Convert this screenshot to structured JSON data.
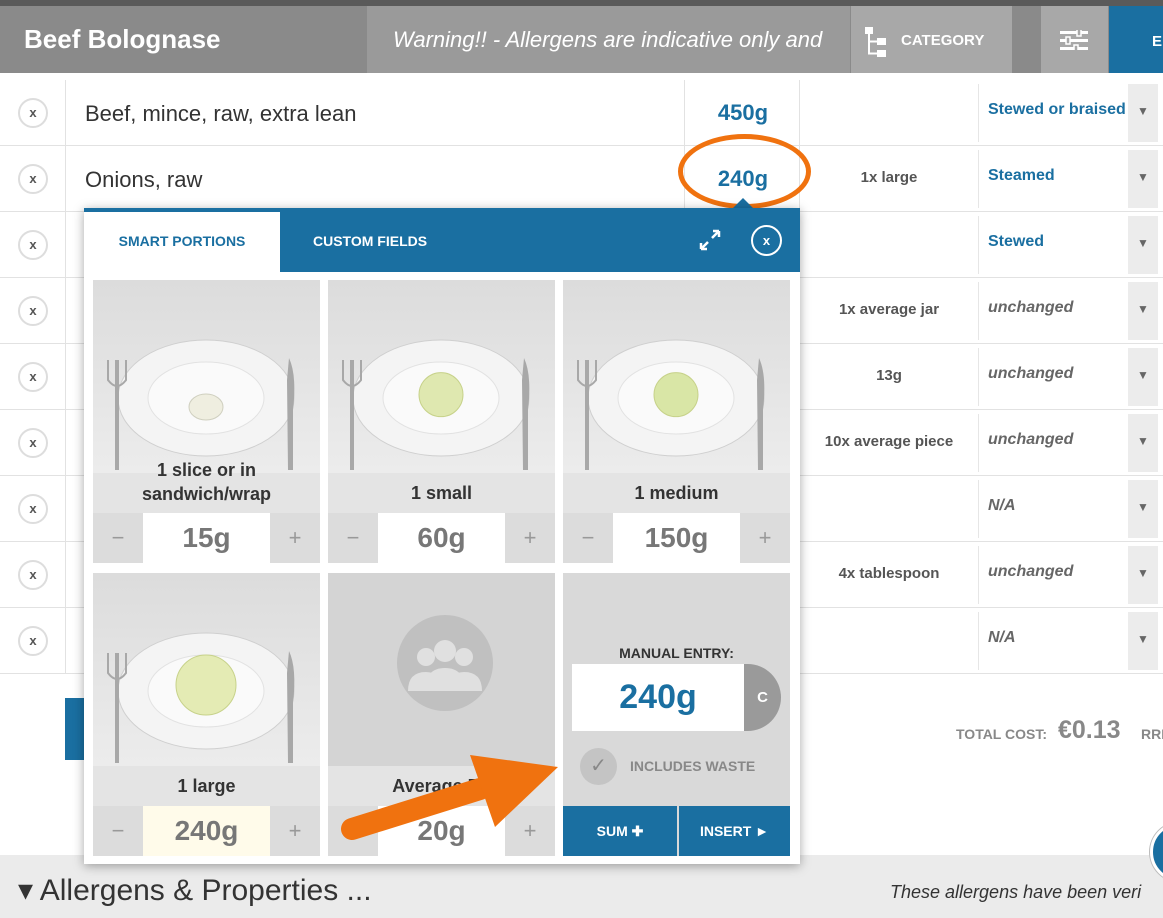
{
  "header": {
    "recipe_title": "Beef Bolognase",
    "warning": "Warning!! - Allergens are indicative only and",
    "category_label": "CATEGORY",
    "export_label": "E"
  },
  "rows": [
    {
      "remove": "x",
      "ingredient": "Beef, mince, raw, extra lean",
      "quantity": "450g",
      "portion": "",
      "cooking": "Stewed or braised"
    },
    {
      "remove": "x",
      "ingredient": "Onions, raw",
      "quantity": "240g",
      "portion": "1x large",
      "cooking": "Steamed"
    },
    {
      "remove": "x",
      "ingredient": "",
      "quantity": "",
      "portion": "",
      "cooking": "Stewed"
    },
    {
      "remove": "x",
      "ingredient": "",
      "quantity": "",
      "portion": "1x average jar",
      "cooking": "unchanged"
    },
    {
      "remove": "x",
      "ingredient": "",
      "quantity": "",
      "portion": "13g",
      "cooking": "unchanged"
    },
    {
      "remove": "x",
      "ingredient": "",
      "quantity": "",
      "portion": "10x average piece",
      "cooking": "unchanged"
    },
    {
      "remove": "x",
      "ingredient": "",
      "quantity": "",
      "portion": "",
      "cooking": "N/A"
    },
    {
      "remove": "x",
      "ingredient": "",
      "quantity": "",
      "portion": "4x tablespoon",
      "cooking": "unchanged"
    },
    {
      "remove": "x",
      "ingredient": "",
      "quantity": "",
      "portion": "",
      "cooking": "N/A"
    }
  ],
  "dropdown_glyph": "▼",
  "popup": {
    "tab_smart": "SMART PORTIONS",
    "tab_custom": "CUSTOM FIELDS",
    "close": "x",
    "cards": [
      {
        "label": "1 slice or in sandwich/wrap",
        "value": "15g",
        "minus": "−",
        "plus": "+"
      },
      {
        "label": "1 small",
        "value": "60g",
        "minus": "−",
        "plus": "+"
      },
      {
        "label": "1 medium",
        "value": "150g",
        "minus": "−",
        "plus": "+"
      },
      {
        "label": "1 large",
        "value": "240g",
        "minus": "−",
        "plus": "+"
      },
      {
        "label": "Average Po",
        "value": "20g",
        "minus": "−",
        "plus": "+"
      }
    ],
    "manual_label": "MANUAL ENTRY:",
    "manual_value": "240g",
    "clear_label": "C",
    "check_glyph": "✓",
    "waste_label": "INCLUDES WASTE",
    "sum_label": "SUM ✚",
    "insert_label": "INSERT ►"
  },
  "totals": {
    "cost_label": "TOTAL COST:",
    "cost_value": "€0.13",
    "rrp_label": "RRP"
  },
  "allergens": {
    "title": "▾ Allergens & Properties ...",
    "note": "These allergens have been veri"
  },
  "colors": {
    "accent": "#1a6fa1",
    "highlight": "#f0720f",
    "header": "#8a8a8a"
  }
}
